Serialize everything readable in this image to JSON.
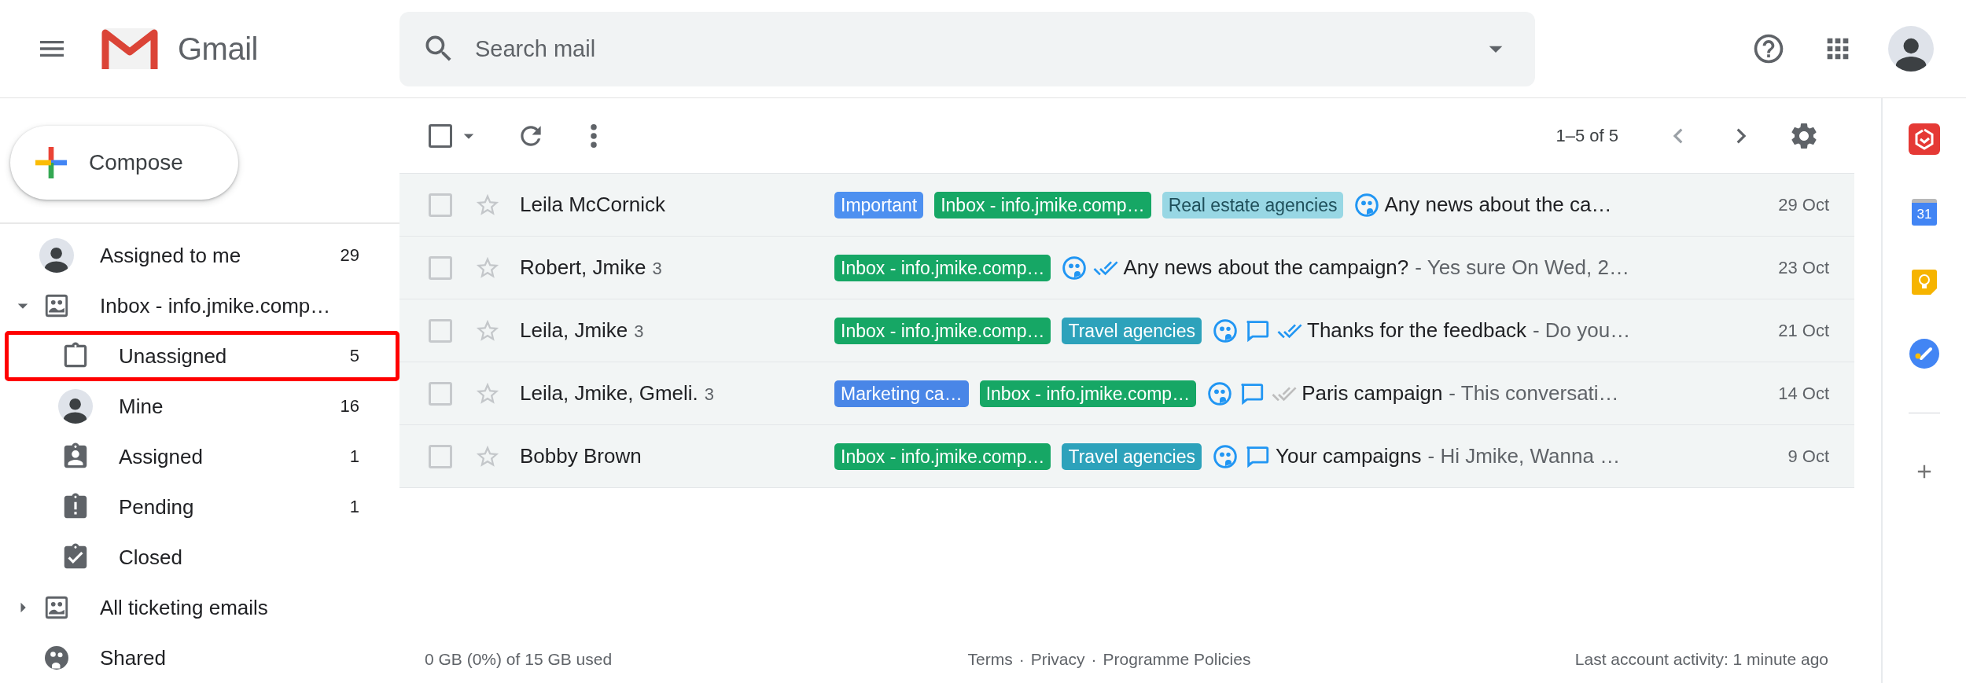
{
  "header": {
    "app_name": "Gmail",
    "search": {
      "placeholder": "Search mail"
    }
  },
  "compose": {
    "label": "Compose"
  },
  "sidebar": {
    "items": [
      {
        "kind": "avatar",
        "label": "Assigned to me",
        "count": "29",
        "outlined": false
      },
      {
        "kind": "inbox",
        "label": "Inbox - info.jmike.comp…",
        "expanded": true,
        "outlined": false,
        "children": [
          {
            "kind": "unassigned",
            "label": "Unassigned",
            "count": "5",
            "outlined": true
          },
          {
            "kind": "avatar",
            "label": "Mine",
            "count": "16",
            "outlined": false
          },
          {
            "kind": "assigned",
            "label": "Assigned",
            "count": "1",
            "outlined": false
          },
          {
            "kind": "pending",
            "label": "Pending",
            "count": "1",
            "outlined": false
          },
          {
            "kind": "closed",
            "label": "Closed",
            "outlined": false
          }
        ]
      },
      {
        "kind": "inbox",
        "label": "All ticketing emails",
        "expanded": false,
        "outlined": false
      },
      {
        "kind": "shared",
        "label": "Shared",
        "outlined": false
      }
    ]
  },
  "toolbar": {
    "select_all": {
      "checked": false
    },
    "range": "1–5 of 5"
  },
  "rows": [
    {
      "sender": "Leila McCornick",
      "read": true,
      "checked": false,
      "starred": false,
      "labels": [
        {
          "text": "Important",
          "color": "#4d90f0"
        },
        {
          "text": "Inbox - info.jmike.comp…",
          "color": "#16a765"
        },
        {
          "text": "Real estate agencies",
          "color": "#98d7e4"
        }
      ],
      "shared": true,
      "comments": false,
      "subject": "Any news about the ca…",
      "date": "29 Oct"
    },
    {
      "sender": "Robert, Jmike",
      "count": "3",
      "read": true,
      "checked": false,
      "starred": false,
      "labels": [
        {
          "text": "Inbox - info.jmike.comp…",
          "color": "#16a765"
        }
      ],
      "shared": true,
      "comments": false,
      "tracked": true,
      "opened": true,
      "subject": "Any news about the campaign?",
      "snippet": "- Yes sure On Wed, 2…",
      "date": "23 Oct"
    },
    {
      "sender": "Leila, Jmike",
      "count": "3",
      "read": true,
      "checked": false,
      "starred": false,
      "labels": [
        {
          "text": "Inbox - info.jmike.comp…",
          "color": "#16a765"
        },
        {
          "text": "Travel agencies",
          "color": "#2da2bb"
        }
      ],
      "shared": true,
      "comments": true,
      "tracked": true,
      "opened": true,
      "subject": "Thanks for the feedback",
      "snippet": "- Do you…",
      "date": "21 Oct"
    },
    {
      "sender": "Leila, Jmike, Gmeli.",
      "count": "3",
      "read": true,
      "checked": false,
      "starred": false,
      "labels": [
        {
          "text": "Marketing ca…",
          "color": "#4986e7"
        },
        {
          "text": "Inbox - info.jmike.comp…",
          "color": "#16a765"
        }
      ],
      "shared": true,
      "comments": true,
      "tracked": true,
      "opened": false,
      "subject": "Paris campaign",
      "snippet": "- This conversati…",
      "date": "14 Oct"
    },
    {
      "sender": "Bobby Brown",
      "read": true,
      "checked": false,
      "starred": false,
      "labels": [
        {
          "text": "Inbox - info.jmike.comp…",
          "color": "#16a765"
        },
        {
          "text": "Travel agencies",
          "color": "#2da2bb"
        }
      ],
      "shared": true,
      "comments": true,
      "subject": "Your campaigns",
      "snippet": "- Hi Jmike, Wanna …",
      "date": "9 Oct"
    }
  ],
  "footer": {
    "storage": "0 GB (0%) of 15 GB used",
    "links": [
      "Terms",
      "Privacy",
      "Programme Policies"
    ],
    "separator": "·",
    "activity": "Last account activity: 1 minute ago"
  },
  "side_panel": {
    "calendar_day": "31"
  }
}
